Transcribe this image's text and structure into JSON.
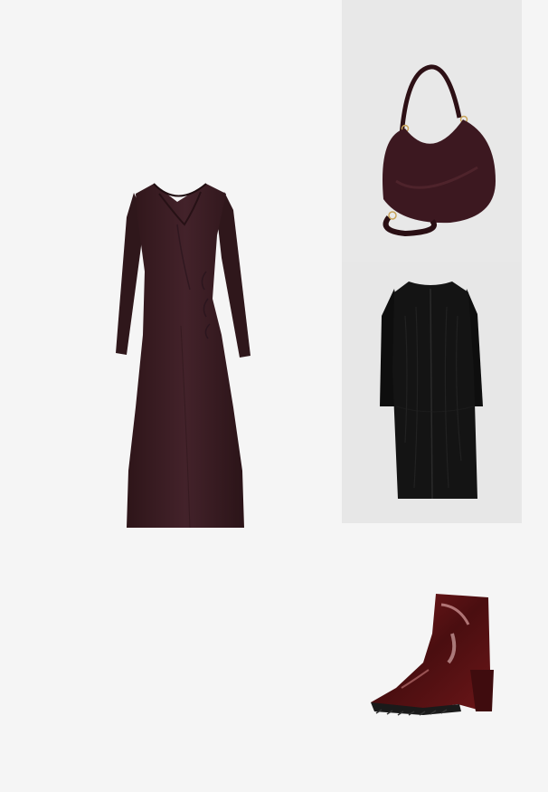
{
  "collage": {
    "background": "#f5f5f5",
    "items": [
      {
        "id": "dress",
        "icon": "midi-dress-icon",
        "color": "#3a1e25",
        "tile_bg": "#f5f5f5"
      },
      {
        "id": "bag",
        "icon": "shoulder-bag-icon",
        "color": "#3c1820",
        "tile_bg": "#e8e8e8"
      },
      {
        "id": "coat",
        "icon": "faux-fur-coat-icon",
        "color": "#121212",
        "tile_bg": "#e7e7e7"
      },
      {
        "id": "boot",
        "icon": "ankle-boot-icon",
        "color": "#5a1214",
        "tile_bg": "#f5f5f5"
      }
    ]
  }
}
